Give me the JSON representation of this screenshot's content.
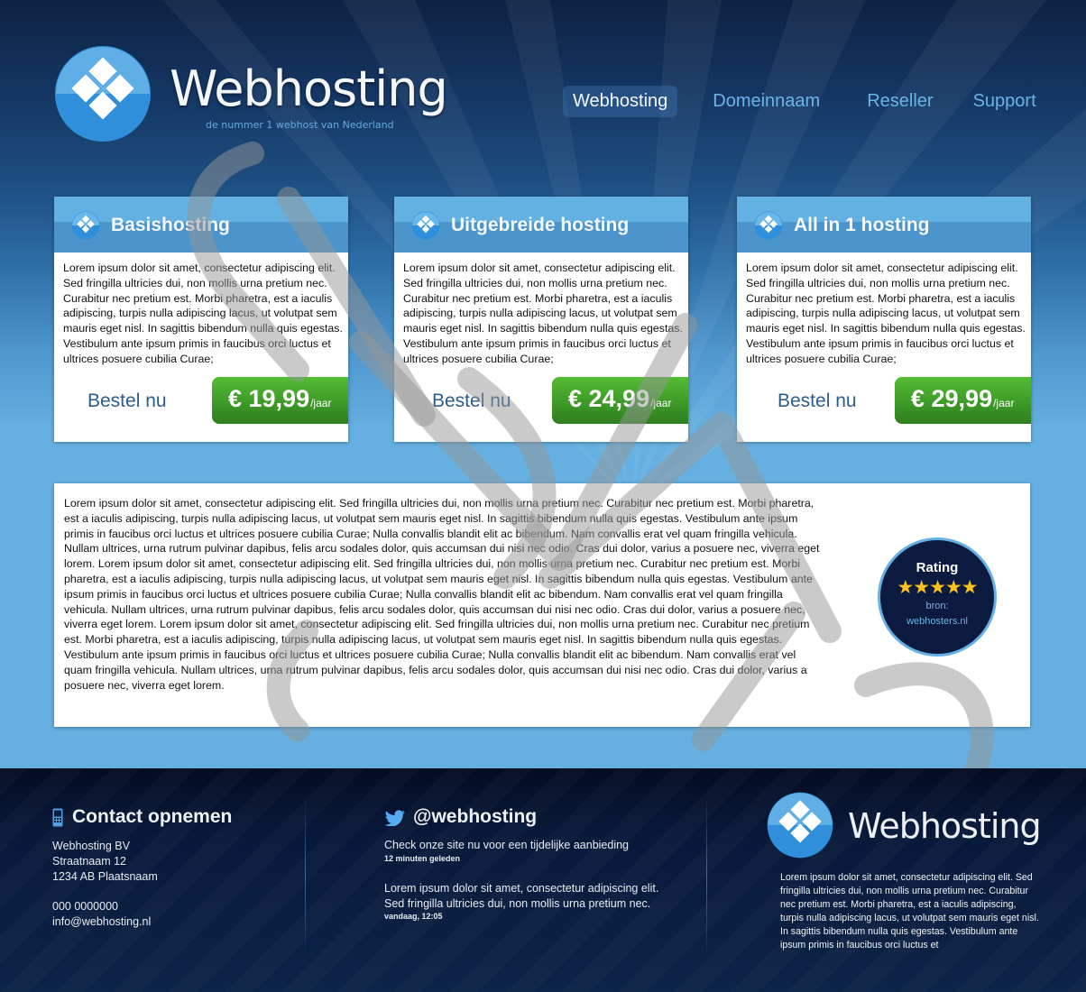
{
  "header": {
    "brand": "Webhosting",
    "tagline": "de nummer 1 webhost van Nederland",
    "logo_icon": "diamond-cluster-logo-icon"
  },
  "nav": {
    "items": [
      {
        "label": "Webhosting",
        "active": true
      },
      {
        "label": "Domeinnaam",
        "active": false
      },
      {
        "label": "Reseller",
        "active": false
      },
      {
        "label": "Support",
        "active": false
      }
    ]
  },
  "cards": [
    {
      "title": "Basishosting",
      "icon": "diamond-cluster-icon",
      "text": "Lorem ipsum dolor sit amet, consectetur adipiscing elit. Sed fringilla ultricies dui, non mollis urna pretium nec. Curabitur nec pretium est. Morbi pharetra, est a iaculis adipiscing, turpis nulla adipiscing lacus, ut volutpat sem mauris eget nisl. In sagittis bibendum nulla quis egestas. Vestibulum ante ipsum primis in faucibus orci luctus et ultrices posuere cubilia Curae;",
      "order_label": "Bestel nu",
      "price": "€ 19,99",
      "price_unit": "/jaar"
    },
    {
      "title": "Uitgebreide hosting",
      "icon": "diamond-cluster-icon",
      "text": "Lorem ipsum dolor sit amet, consectetur adipiscing elit. Sed fringilla ultricies dui, non mollis urna pretium nec. Curabitur nec pretium est. Morbi pharetra, est a iaculis adipiscing, turpis nulla adipiscing lacus, ut volutpat sem mauris eget nisl. In sagittis bibendum nulla quis egestas. Vestibulum ante ipsum primis in faucibus orci luctus et ultrices posuere cubilia Curae;",
      "order_label": "Bestel nu",
      "price": "€ 24,99",
      "price_unit": "/jaar"
    },
    {
      "title": "All in 1 hosting",
      "icon": "diamond-cluster-icon",
      "text": "Lorem ipsum dolor sit amet, consectetur adipiscing elit. Sed fringilla ultricies dui, non mollis urna pretium nec. Curabitur nec pretium est. Morbi pharetra, est a iaculis adipiscing, turpis nulla adipiscing lacus, ut volutpat sem mauris eget nisl. In sagittis bibendum nulla quis egestas. Vestibulum ante ipsum primis in faucibus orci luctus et ultrices posuere cubilia Curae;",
      "order_label": "Bestel nu",
      "price": "€ 29,99",
      "price_unit": "/jaar"
    }
  ],
  "content": {
    "text": "Lorem ipsum dolor sit amet, consectetur adipiscing elit. Sed fringilla ultricies dui, non mollis urna pretium nec. Curabitur nec pretium est. Morbi pharetra, est a iaculis adipiscing, turpis nulla adipiscing lacus, ut volutpat sem mauris eget nisl. In sagittis bibendum nulla quis egestas. Vestibulum ante ipsum primis in faucibus orci luctus et ultrices posuere cubilia Curae; Nulla convallis blandit elit ac bibendum. Nam convallis erat vel quam fringilla vehicula. Nullam ultrices, urna rutrum pulvinar dapibus, felis arcu sodales dolor, quis accumsan dui nisi nec odio. Cras dui dolor, varius a posuere nec, viverra eget lorem. Lorem ipsum dolor sit amet, consectetur adipiscing elit. Sed fringilla ultricies dui, non mollis urna pretium nec. Curabitur nec pretium est. Morbi pharetra, est a iaculis adipiscing, turpis nulla adipiscing lacus, ut volutpat sem mauris eget nisl. In sagittis bibendum nulla quis egestas. Vestibulum ante ipsum primis in faucibus orci luctus et ultrices posuere cubilia Curae; Nulla convallis blandit elit ac bibendum. Nam convallis erat vel quam fringilla vehicula. Nullam ultrices, urna rutrum pulvinar dapibus, felis arcu sodales dolor, quis accumsan dui nisi nec odio. Cras dui dolor, varius a posuere nec, viverra eget lorem. Lorem ipsum dolor sit amet, consectetur adipiscing elit. Sed fringilla ultricies dui, non mollis urna pretium nec. Curabitur nec pretium est. Morbi pharetra, est a iaculis adipiscing, turpis nulla adipiscing lacus, ut volutpat sem mauris eget nisl. In sagittis bibendum nulla quis egestas. Vestibulum ante ipsum primis in faucibus orci luctus et ultrices posuere cubilia Curae; Nulla convallis blandit elit ac bibendum. Nam convallis erat vel quam fringilla vehicula. Nullam ultrices, urna rutrum pulvinar dapibus, felis arcu sodales dolor, quis accumsan dui nisi nec odio. Cras dui dolor, varius a posuere nec, viverra eget lorem."
  },
  "rating": {
    "title": "Rating",
    "stars": 5,
    "stars_max": 5,
    "stars_text": "★★★★★",
    "source_label": "bron:",
    "source": "webhosters.nl"
  },
  "footer": {
    "contact": {
      "icon": "mobile-phone-icon",
      "heading": "Contact opnemen",
      "company": "Webhosting BV",
      "street": "Straatnaam 12",
      "city": "1234 AB Plaatsnaam",
      "phone": "000 0000000",
      "email": "info@webhosting.nl"
    },
    "twitter": {
      "icon": "twitter-bird-icon",
      "handle": "@webhosting",
      "tweets": [
        {
          "text": "Check onze site nu voor een tijdelijke aanbieding",
          "time": "12 minuten geleden"
        },
        {
          "text": "Lorem ipsum dolor sit amet, consectetur adipiscing elit. Sed fringilla ultricies dui, non mollis urna pretium  nec.",
          "time": "vandaag, 12:05"
        }
      ]
    },
    "brand": "Webhosting",
    "about": "Lorem ipsum dolor sit amet, consectetur adipiscing elit. Sed fringilla ultricies dui, non mollis urna pretium nec. Curabitur nec pretium est. Morbi pharetra, est a iaculis adipiscing, turpis nulla adipiscing lacus, ut volutpat sem mauris eget nisl. In sagittis bibendum nulla quis egestas. Vestibulum ante ipsum primis in faucibus orci luctus et"
  },
  "colors": {
    "header_dark": "#0e2243",
    "page_blue": "#65b0e1",
    "card_head": "#4b94cc",
    "price_green": "#3e9a28",
    "order_text": "#2c5b8d",
    "nav_link": "#6ab4e8",
    "rating_bg": "#0c1a3f",
    "star": "#f7c21d",
    "footer_bg": "#08193a"
  }
}
